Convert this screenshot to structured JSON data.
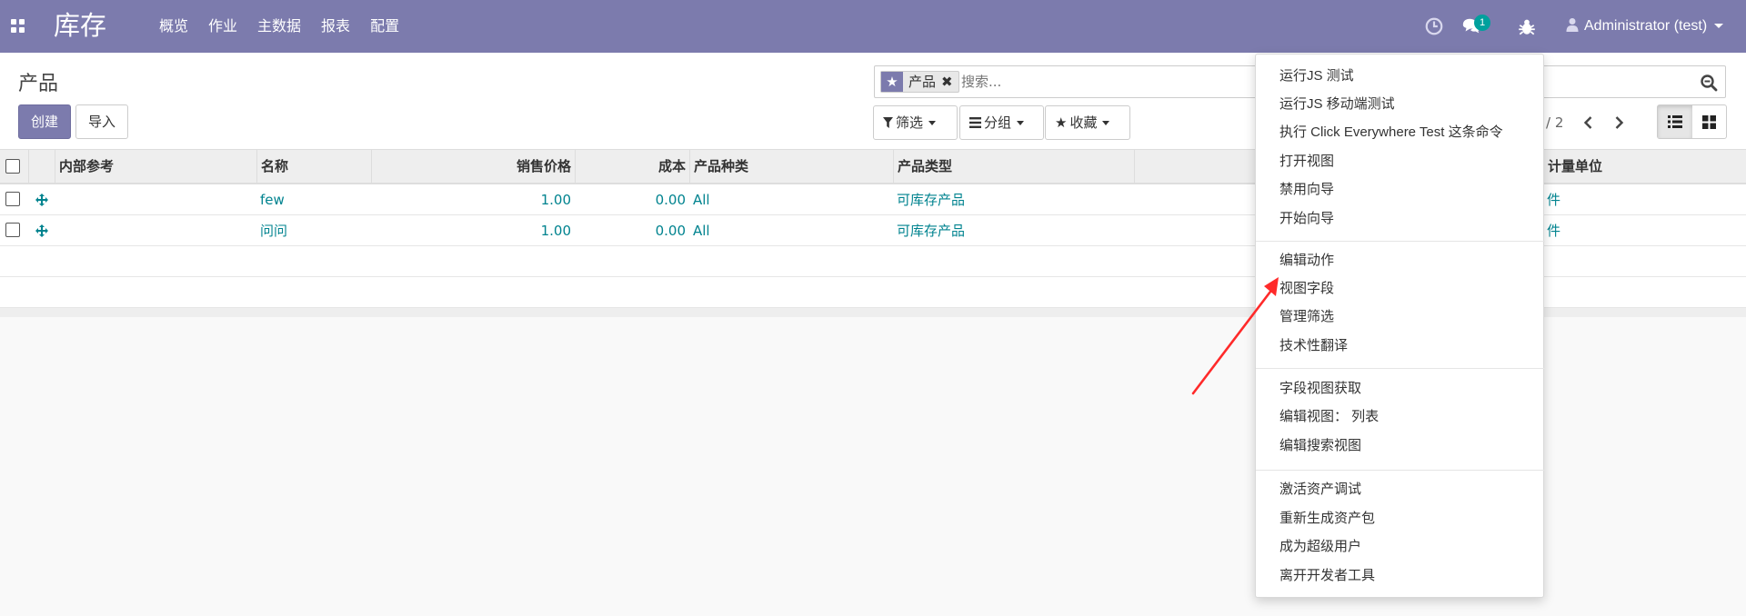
{
  "navbar": {
    "brand": "库存",
    "menu": [
      "概览",
      "作业",
      "主数据",
      "报表",
      "配置"
    ],
    "chat_badge": "1",
    "user": "Administrator (test)"
  },
  "control": {
    "title": "产品",
    "create_label": "创建",
    "import_label": "导入",
    "search_facet": "产品",
    "search_placeholder": "搜索...",
    "filter_label": "筛选",
    "group_label": "分组",
    "favorites_label": "收藏",
    "pager": "/ 2"
  },
  "table": {
    "headers": {
      "internal_ref": "内部参考",
      "name": "名称",
      "sale_price": "销售价格",
      "cost": "成本",
      "category": "产品种类",
      "type": "产品类型",
      "uom": "计量单位"
    },
    "rows": [
      {
        "name": "few",
        "sale_price": "1.00",
        "cost": "0.00",
        "category": "All",
        "type": "可库存产品",
        "uom": "件"
      },
      {
        "name": "问问",
        "sale_price": "1.00",
        "cost": "0.00",
        "category": "All",
        "type": "可库存产品",
        "uom": "件"
      }
    ]
  },
  "debug_menu": {
    "group1": [
      "运行JS 测试",
      "运行JS 移动端测试",
      "执行 Click Everywhere Test 这条命令",
      "打开视图",
      "禁用向导",
      "开始向导"
    ],
    "group2": [
      "编辑动作",
      "视图字段",
      "管理筛选",
      "技术性翻译"
    ],
    "group3": [
      "字段视图获取",
      "编辑视图： 列表",
      "编辑搜索视图"
    ],
    "group4": [
      "激活资产调试",
      "重新生成资产包",
      "成为超级用户",
      "离开开发者工具"
    ]
  },
  "colors": {
    "brand": "#7c7bad",
    "link": "#00838f",
    "badge": "#00a09d",
    "annotation_arrow": "#ff2a2a"
  }
}
